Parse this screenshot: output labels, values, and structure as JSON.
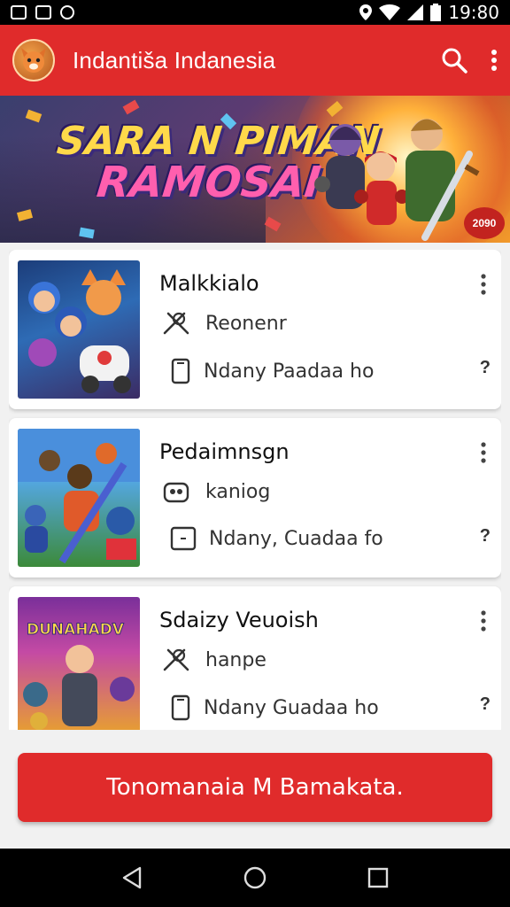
{
  "status_bar": {
    "time": "19:80"
  },
  "app_bar": {
    "title": "Indantiša Indanesia"
  },
  "banner": {
    "line1": "SARA N PIMAN",
    "line2": "RAMOSAI",
    "badge": "2090"
  },
  "cards": [
    {
      "title": "Malkkialo",
      "row1": "Reonenr",
      "row2": "Ndany Paadaa ho",
      "help": "?"
    },
    {
      "title": "Pedaimnsgn",
      "row1": "kaniog",
      "row2": "Ndany, Cuadaa fo",
      "help": "?"
    },
    {
      "title": "Sdaizy Veuoish",
      "row1": "hanpe",
      "row2": "Ndany Guadaa ho",
      "help": "?"
    }
  ],
  "thumb3_caption": "DUNAHADV",
  "cta": {
    "label": "Tonomanaia M Bamakata."
  },
  "colors": {
    "primary": "#e02b2b",
    "background": "#f1f1f1"
  }
}
